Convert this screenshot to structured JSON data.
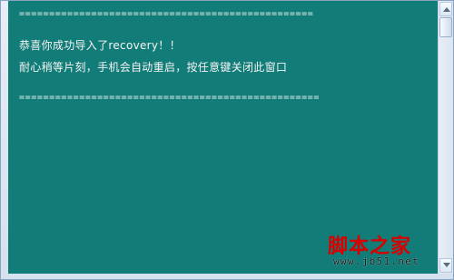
{
  "console": {
    "separator_top": "=================================================",
    "line_1": "恭喜你成功导入了recovery！！",
    "line_2": "耐心稍等片刻，手机会自动重启，按任意键关闭此窗口",
    "separator_bottom": "=================================================="
  },
  "watermark": {
    "text": "脚本之家",
    "url": "www.jb51.net"
  }
}
